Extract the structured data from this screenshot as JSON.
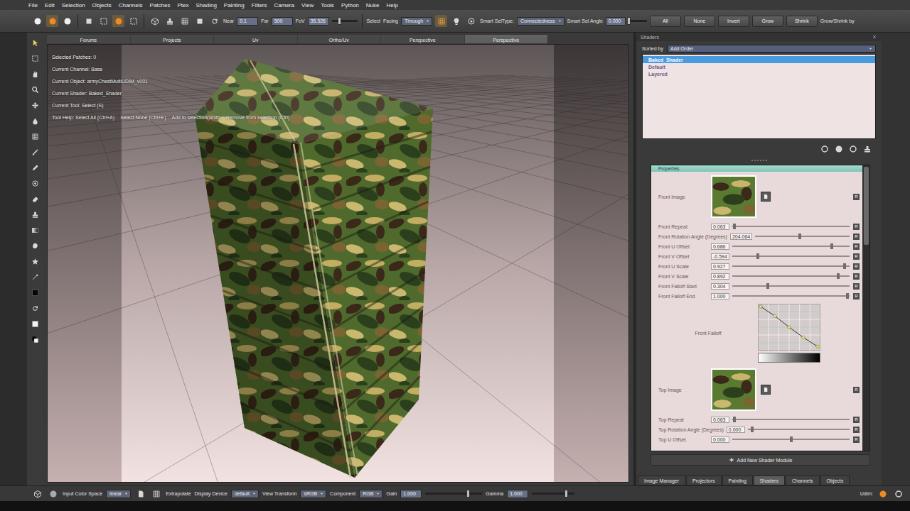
{
  "menu": [
    "File",
    "Edit",
    "Selection",
    "Objects",
    "Channels",
    "Patches",
    "Ptex",
    "Shading",
    "Painting",
    "Filters",
    "Camera",
    "View",
    "Tools",
    "Python",
    "Nuke",
    "Help"
  ],
  "toolbar": {
    "selection_modes": [
      {
        "selected": false
      },
      {
        "selected": true
      },
      {
        "selected": false
      }
    ],
    "select_tools": [
      {
        "selected": false
      },
      {
        "selected": true
      },
      {
        "selected": false
      }
    ],
    "near": {
      "label": "Near",
      "value": "0.1"
    },
    "far": {
      "label": "Far",
      "value": "500"
    },
    "fov": {
      "label": "FoV",
      "value": "35.326",
      "level": 0.3
    },
    "select_label": "Select",
    "facing": {
      "label": "Facing",
      "value": "Through"
    },
    "smart_sel_type": {
      "label": "Smart SelType:",
      "value": "Connectedness"
    },
    "smart_sel_angle": {
      "label": "Smart Sel Angle",
      "value": "0.000",
      "level": 0.0
    },
    "buttons": [
      "All",
      "None",
      "Invert",
      "Grow",
      "Shrink"
    ],
    "grow_shrink_label": "Grow/Shrink by"
  },
  "viewport": {
    "tabs": [
      {
        "label": "Forums",
        "selected": false
      },
      {
        "label": "Projects",
        "selected": false
      },
      {
        "label": "Uv",
        "selected": false
      },
      {
        "label": "Ortho/Uv",
        "selected": false
      },
      {
        "label": "Perspective",
        "selected": false
      },
      {
        "label": "Perspective",
        "selected": true
      }
    ],
    "info": [
      "Selected Patches: 0",
      "Current Channel: Base",
      "Current Object: armyChestMultiUDIM_v001",
      "Current Shader: Baked_Shader",
      "Current Tool: Select (S)"
    ],
    "tool_help": [
      "Tool Help: Select All (Ctrl+A)",
      "Select None (Ctrl+E)",
      "Add to selection(Shift)",
      "Remove from selection (Ctrl)"
    ]
  },
  "shaders": {
    "title": "Shaders",
    "sort_label": "Sorted by",
    "sort_value": "Add Order",
    "items": [
      {
        "label": "Baked_Shader",
        "selected": true
      },
      {
        "label": "Default",
        "selected": false
      },
      {
        "label": "Layered",
        "selected": false
      }
    ]
  },
  "properties": {
    "title": "Properties",
    "rows": [
      {
        "kind": "image",
        "label": "Front Image",
        "reset": "R"
      },
      {
        "kind": "slider",
        "label": "Front Repeat",
        "value": "0.063",
        "level": 0.02,
        "reset": "R"
      },
      {
        "kind": "slider",
        "label": "Front Rotation Angle (Degrees)",
        "value": "204.064",
        "level": 0.47,
        "reset": "R"
      },
      {
        "kind": "slider",
        "label": "Front U Offset",
        "value": "0.686",
        "level": 0.85,
        "reset": "R"
      },
      {
        "kind": "slider",
        "label": "Front V Offset",
        "value": "-0.594",
        "level": 0.22,
        "reset": "R"
      },
      {
        "kind": "slider",
        "label": "Front U Scale",
        "value": "0.927",
        "level": 0.96,
        "reset": "R"
      },
      {
        "kind": "slider",
        "label": "Front V Scale",
        "value": "0.892",
        "level": 0.9,
        "reset": "R"
      },
      {
        "kind": "slider",
        "label": "Front Falloff Start",
        "value": "0.304",
        "level": 0.3,
        "reset": "R"
      },
      {
        "kind": "slider",
        "label": "Front Falloff End",
        "value": "1.000",
        "level": 0.98,
        "reset": "R"
      },
      {
        "kind": "curve",
        "label": "Front Falloff",
        "values": [
          1,
          0.77,
          0.5,
          0.25,
          0.03
        ]
      },
      {
        "kind": "image",
        "label": "Top Image",
        "reset": "R"
      },
      {
        "kind": "slider",
        "label": "Top Repeat",
        "value": "0.063",
        "level": 0.02,
        "reset": "R"
      },
      {
        "kind": "slider",
        "label": "Top Rotation Angle (Degrees)",
        "value": "0.000",
        "level": 0.04,
        "reset": "R"
      },
      {
        "kind": "slider",
        "label": "Top U Offset",
        "value": "0.000",
        "level": 0.5,
        "reset": "R"
      }
    ],
    "add_button": "Add New Shader Module"
  },
  "panel_tabs": [
    {
      "label": "Image Manager",
      "selected": false
    },
    {
      "label": "Projectors",
      "selected": false
    },
    {
      "label": "Painting",
      "selected": false
    },
    {
      "label": "Shaders",
      "selected": true
    },
    {
      "label": "Channels",
      "selected": false
    },
    {
      "label": "Objects",
      "selected": false
    }
  ],
  "bottom_bar": {
    "input_color_space": {
      "label": "Input Color Space",
      "value": "linear"
    },
    "extrapolate_label": "Extrapolate",
    "display_device": {
      "label": "Display Device",
      "value": "default"
    },
    "view_transform": {
      "label": "View Transform",
      "value": "sRGB"
    },
    "component": {
      "label": "Component",
      "value": "RGB"
    },
    "gain": {
      "label": "Gain",
      "value": "1.000",
      "level": 0.75
    },
    "gamma": {
      "label": "Gamma",
      "value": "1.000",
      "level": 0.8
    },
    "udim_label": "Udim:"
  }
}
